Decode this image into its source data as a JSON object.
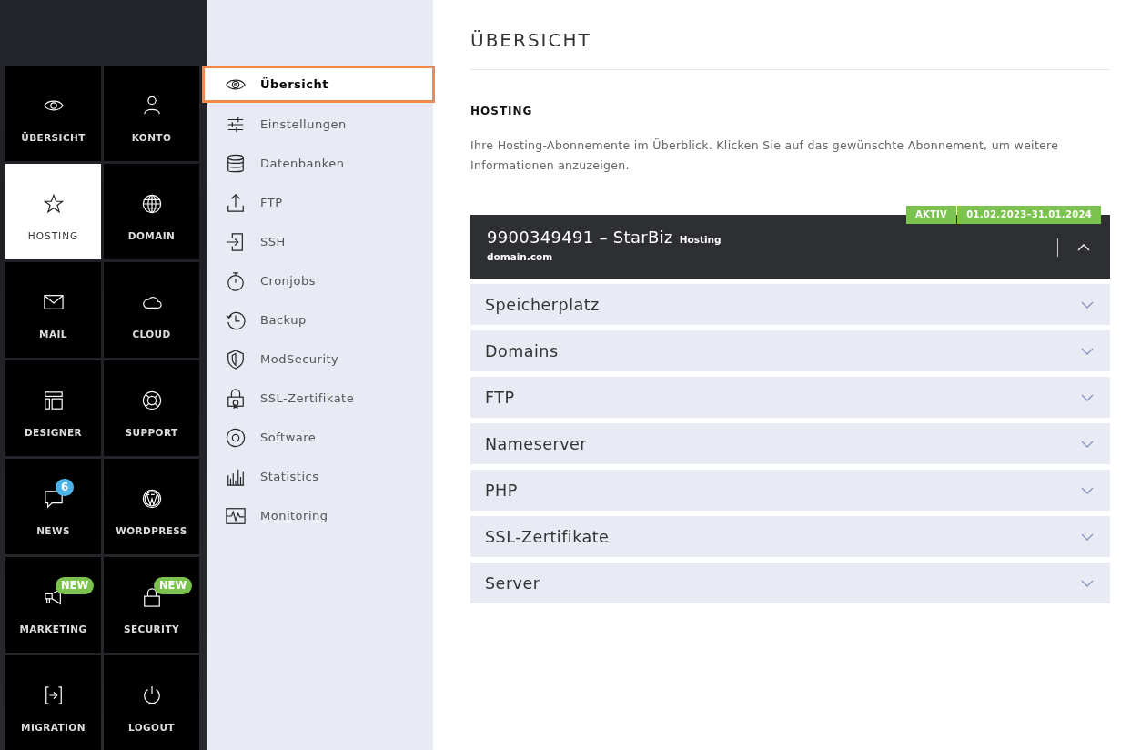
{
  "tiles": [
    {
      "label": "ÜBERSICHT",
      "selected": false
    },
    {
      "label": "KONTO",
      "selected": false
    },
    {
      "label": "HOSTING",
      "selected": true
    },
    {
      "label": "DOMAIN",
      "selected": false
    },
    {
      "label": "MAIL",
      "selected": false
    },
    {
      "label": "CLOUD",
      "selected": false
    },
    {
      "label": "DESIGNER",
      "selected": false
    },
    {
      "label": "SUPPORT",
      "selected": false
    },
    {
      "label": "NEWS",
      "selected": false,
      "badge": {
        "text": "6",
        "color": "#4ab4ea"
      }
    },
    {
      "label": "WORDPRESS",
      "selected": false
    },
    {
      "label": "MARKETING",
      "selected": false,
      "badge": {
        "text": "NEW",
        "color": "#7cc24e"
      }
    },
    {
      "label": "SECURITY",
      "selected": false,
      "badge": {
        "text": "NEW",
        "color": "#7cc24e"
      }
    },
    {
      "label": "MIGRATION",
      "selected": false
    },
    {
      "label": "LOGOUT",
      "selected": false
    }
  ],
  "submenu": [
    {
      "label": "Übersicht",
      "selected": true
    },
    {
      "label": "Einstellungen",
      "selected": false
    },
    {
      "label": "Datenbanken",
      "selected": false
    },
    {
      "label": "FTP",
      "selected": false
    },
    {
      "label": "SSH",
      "selected": false
    },
    {
      "label": "Cronjobs",
      "selected": false
    },
    {
      "label": "Backup",
      "selected": false
    },
    {
      "label": "ModSecurity",
      "selected": false
    },
    {
      "label": "SSL-Zertifikate",
      "selected": false
    },
    {
      "label": "Software",
      "selected": false
    },
    {
      "label": "Statistics",
      "selected": false
    },
    {
      "label": "Monitoring",
      "selected": false
    }
  ],
  "page_title": "ÜBERSICHT",
  "section_title": "HOSTING",
  "intro": "Ihre Hosting-Abonnemente im Überblick. Klicken Sie auf das gewünschte Abonnement, um weitere Informationen anzuzeigen.",
  "subscription": {
    "title": "9900349491 – StarBiz",
    "type": "Hosting",
    "domain": "domain.com",
    "status": "AKTIV",
    "period": "01.02.2023–31.01.2024",
    "expanded": true
  },
  "sections": [
    {
      "label": "Speicherplatz",
      "expanded": false
    },
    {
      "label": "Domains",
      "expanded": false
    },
    {
      "label": "FTP",
      "expanded": false
    },
    {
      "label": "Nameserver",
      "expanded": false
    },
    {
      "label": "PHP",
      "expanded": false
    },
    {
      "label": "SSL-Zertifikate",
      "expanded": false
    },
    {
      "label": "Server",
      "expanded": false
    }
  ]
}
